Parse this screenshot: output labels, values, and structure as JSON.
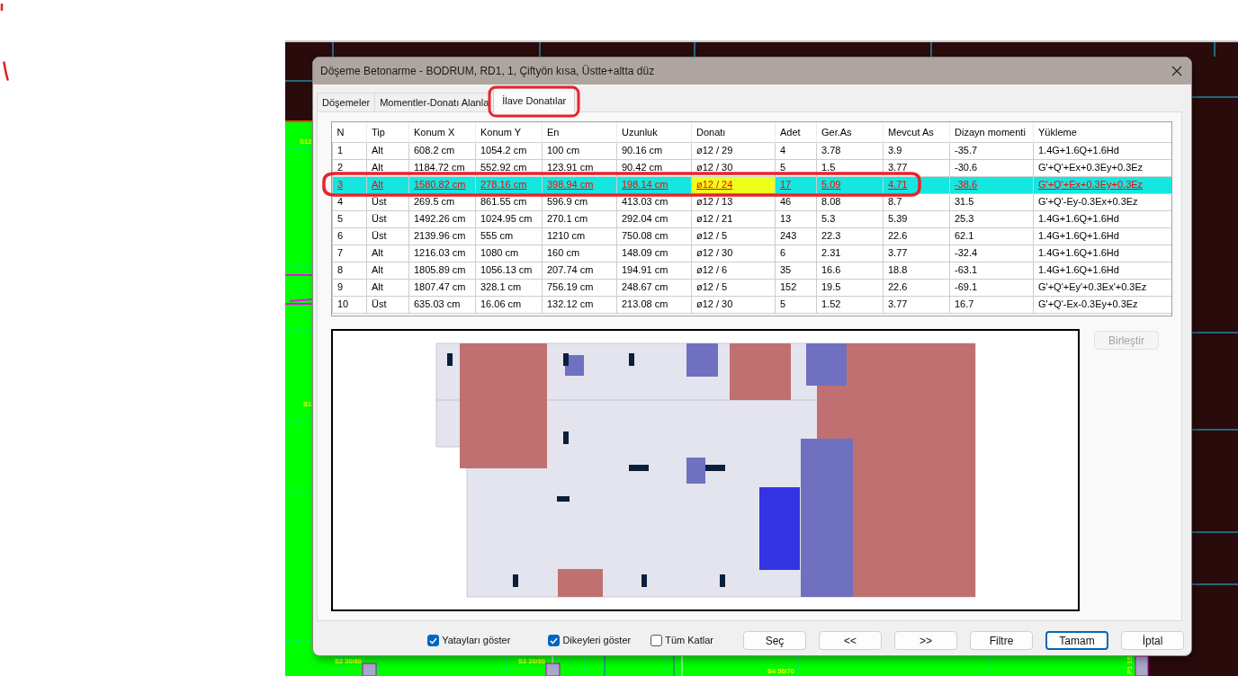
{
  "window": {
    "title": "Döşeme Betonarme - BODRUM, RD1, 1, Çiftyön kısa, Üstte+altta düz"
  },
  "tabs": [
    {
      "label": "Döşemeler",
      "selected": false
    },
    {
      "label": "Momentler-Donatı Alanla",
      "selected": false
    },
    {
      "label": "İlave Donatılar",
      "selected": true
    }
  ],
  "table": {
    "columns": [
      {
        "label": "N",
        "focused": false
      },
      {
        "label": "Tip",
        "focused": false
      },
      {
        "label": "Konum X",
        "focused": false
      },
      {
        "label": "Konum Y",
        "focused": false
      },
      {
        "label": "En",
        "focused": false
      },
      {
        "label": "Uzunluk",
        "focused": false
      },
      {
        "label": "Donatı",
        "focused": true
      },
      {
        "label": "Adet",
        "focused": false
      },
      {
        "label": "Ger.As",
        "focused": false
      },
      {
        "label": "Mevcut As",
        "focused": false
      },
      {
        "label": "Dizayn momenti",
        "focused": false
      },
      {
        "label": "Yükleme",
        "focused": false
      }
    ],
    "rows": [
      {
        "cells": [
          "1",
          "Alt",
          "608.2 cm",
          "1054.2 cm",
          "100 cm",
          "90.16 cm",
          "ø12 / 29",
          "4",
          "3.78",
          "3.9",
          "-35.7",
          "1.4G+1.6Q+1.6Hd"
        ],
        "selected": false
      },
      {
        "cells": [
          "2",
          "Alt",
          "1184.72 cm",
          "552.92 cm",
          "123.91 cm",
          "90.42 cm",
          "ø12 / 30",
          "5",
          "1.5",
          "3.77",
          "-30.6",
          "G'+Q'+Ex+0.3Ey+0.3Ez"
        ],
        "selected": false
      },
      {
        "cells": [
          "3",
          "Alt",
          "1580.82 cm",
          "278.16 cm",
          "398.94 cm",
          "198.14 cm",
          "ø12 / 24",
          "17",
          "5.09",
          "4.71",
          "-38.6",
          "G'+Q'+Ex+0.3Ey+0.3Ez"
        ],
        "selected": true
      },
      {
        "cells": [
          "4",
          "Üst",
          "269.5 cm",
          "861.55 cm",
          "596.9 cm",
          "413.03 cm",
          "ø12 / 13",
          "46",
          "8.08",
          "8.7",
          "31.5",
          "G'+Q'-Ey-0.3Ex+0.3Ez"
        ],
        "selected": false
      },
      {
        "cells": [
          "5",
          "Üst",
          "1492.26 cm",
          "1024.95 cm",
          "270.1 cm",
          "292.04 cm",
          "ø12 / 21",
          "13",
          "5.3",
          "5.39",
          "25.3",
          "1.4G+1.6Q+1.6Hd"
        ],
        "selected": false
      },
      {
        "cells": [
          "6",
          "Üst",
          "2139.96 cm",
          "555 cm",
          "1210 cm",
          "750.08 cm",
          "ø12 / 5",
          "243",
          "22.3",
          "22.6",
          "62.1",
          "1.4G+1.6Q+1.6Hd"
        ],
        "selected": false
      },
      {
        "cells": [
          "7",
          "Alt",
          "1216.03 cm",
          "1080 cm",
          "160 cm",
          "148.09 cm",
          "ø12 / 30",
          "6",
          "2.31",
          "3.77",
          "-32.4",
          "1.4G+1.6Q+1.6Hd"
        ],
        "selected": false
      },
      {
        "cells": [
          "8",
          "Alt",
          "1805.89 cm",
          "1056.13 cm",
          "207.74 cm",
          "194.91 cm",
          "ø12 / 6",
          "35",
          "16.6",
          "18.8",
          "-63.1",
          "1.4G+1.6Q+1.6Hd"
        ],
        "selected": false
      },
      {
        "cells": [
          "9",
          "Alt",
          "1807.47 cm",
          "328.1 cm",
          "756.19 cm",
          "248.67 cm",
          "ø12 / 5",
          "152",
          "19.5",
          "22.6",
          "-69.1",
          "G'+Q'+Ey'+0.3Ex'+0.3Ez"
        ],
        "selected": false
      },
      {
        "cells": [
          "10",
          "Üst",
          "635.03 cm",
          "16.06 cm",
          "132.12 cm",
          "213.08 cm",
          "ø12 / 30",
          "5",
          "1.52",
          "3.77",
          "16.7",
          "G'+Q'-Ex-0.3Ey+0.3Ez"
        ],
        "selected": false
      }
    ]
  },
  "merge_button": {
    "label": "Birleştir",
    "disabled": true
  },
  "options": [
    {
      "label": "Yatayları göster",
      "checked": true
    },
    {
      "label": "Dikeyleri göster",
      "checked": true
    },
    {
      "label": "Tüm Katlar",
      "checked": false
    }
  ],
  "buttons": [
    {
      "label": "Seç",
      "default": false
    },
    {
      "label": "<<",
      "default": false
    },
    {
      "label": ">>",
      "default": false
    },
    {
      "label": "Filtre",
      "default": false
    },
    {
      "label": "Tamam",
      "default": true
    },
    {
      "label": "İptal",
      "default": false
    }
  ],
  "cad_labels": [
    "S12",
    "S1",
    "S2 30/60",
    "S3 30/60",
    "S4 50/70",
    "P1 15"
  ]
}
